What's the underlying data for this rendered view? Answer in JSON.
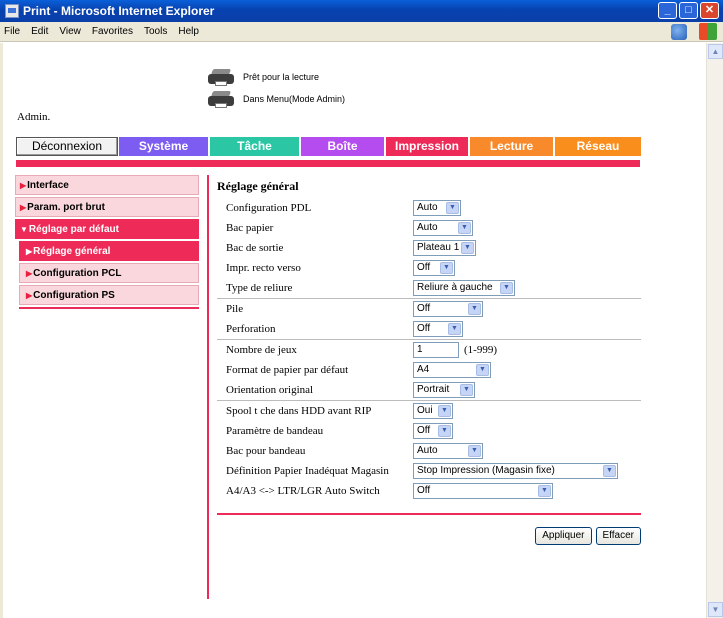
{
  "window": {
    "title": "Print - Microsoft Internet Explorer",
    "minimize": "_",
    "maximize": "□",
    "close": "✕"
  },
  "menu": [
    "File",
    "Edit",
    "View",
    "Favorites",
    "Tools",
    "Help"
  ],
  "status": {
    "line1": "Prêt pour la lecture",
    "line2": "Dans Menu(Mode Admin)"
  },
  "user": "Admin.",
  "tabs": {
    "logout": "Déconnexion",
    "items": [
      {
        "label": "Système",
        "color": "#7d5cf2"
      },
      {
        "label": "Tâche",
        "color": "#2bc7a5"
      },
      {
        "label": "Boîte",
        "color": "#b44cf0"
      },
      {
        "label": "Impression",
        "color": "#ee2b58"
      },
      {
        "label": "Lecture",
        "color": "#f88a2c"
      },
      {
        "label": "Réseau",
        "color": "#f98e1d"
      }
    ]
  },
  "nav": {
    "interface": "Interface",
    "raw_port": "Param. port brut",
    "defaults": "Réglage par défaut",
    "general": "Réglage général",
    "pcl": "Configuration PCL",
    "ps": "Configuration PS"
  },
  "form": {
    "title": "Réglage général",
    "rows": [
      {
        "label": "Configuration PDL",
        "value": "Auto"
      },
      {
        "label": "Bac papier",
        "value": "Auto"
      },
      {
        "label": "Bac de sortie",
        "value": "Plateau 1"
      },
      {
        "label": "Impr. recto verso",
        "value": "Off"
      },
      {
        "label": "Type de reliure",
        "value": "Reliure à gauche"
      },
      {
        "label": "Pile",
        "value": "Off"
      },
      {
        "label": "Perforation",
        "value": "Off"
      },
      {
        "label": "Nombre de jeux",
        "value": "1",
        "hint": "(1-999)"
      },
      {
        "label": "Format de papier par défaut",
        "value": "A4"
      },
      {
        "label": "Orientation original",
        "value": "Portrait"
      },
      {
        "label": "Spool t che dans HDD avant RIP",
        "value": "Oui"
      },
      {
        "label": "Paramètre de bandeau",
        "value": "Off"
      },
      {
        "label": "Bac pour bandeau",
        "value": "Auto"
      },
      {
        "label": "Définition Papier Inadéquat Magasin",
        "value": "Stop Impression (Magasin fixe)"
      },
      {
        "label": "A4/A3 <-> LTR/LGR Auto Switch",
        "value": "Off"
      }
    ],
    "apply": "Appliquer",
    "clear": "Effacer"
  }
}
